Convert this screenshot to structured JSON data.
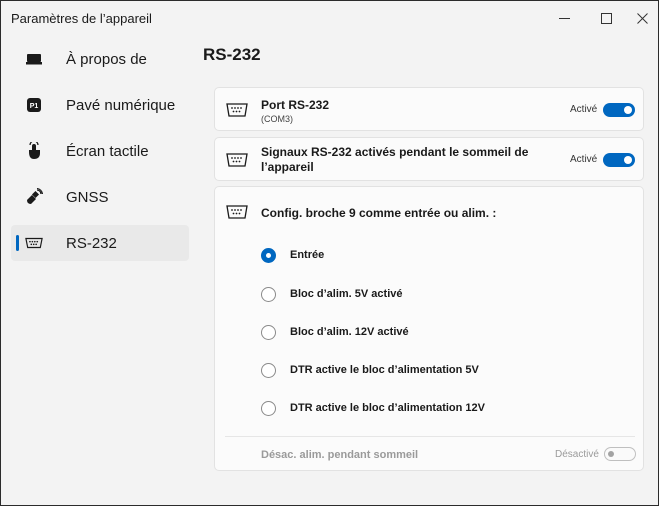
{
  "window": {
    "title": "Paramètres de l’appareil",
    "controls": {
      "minimize": "minimize-icon",
      "maximize": "maximize-icon",
      "close": "close-icon"
    }
  },
  "sidebar": {
    "items": [
      {
        "label": "À propos de",
        "icon": "keyboard-icon",
        "active": false
      },
      {
        "label": "Pavé numérique",
        "icon": "p1-key-icon",
        "active": false
      },
      {
        "label": "Écran tactile",
        "icon": "touch-hand-icon",
        "active": false
      },
      {
        "label": "GNSS",
        "icon": "satellite-icon",
        "active": false
      },
      {
        "label": "RS-232",
        "icon": "serial-port-icon",
        "active": true
      }
    ]
  },
  "page": {
    "title": "RS-232",
    "port": {
      "title": "Port RS-232",
      "subtitle": "(COM3)",
      "toggle_label": "Activé",
      "enabled": true
    },
    "sleep_signals": {
      "title_line1": "Signaux RS-232 activés pendant le sommeil de",
      "title_line2": "l’appareil",
      "toggle_label": "Activé",
      "enabled": true
    },
    "pin9": {
      "title": "Config. broche 9 comme entrée ou alim. :",
      "options": [
        {
          "label": "Entrée",
          "checked": true
        },
        {
          "label": "Bloc d’alim. 5V activé",
          "checked": false
        },
        {
          "label": "Bloc d’alim. 12V activé",
          "checked": false
        },
        {
          "label": "DTR active le bloc d’alimentation 5V",
          "checked": false
        },
        {
          "label": "DTR active le bloc d’alimentation 12V",
          "checked": false
        }
      ],
      "sleep_power": {
        "label": "Désac. alim. pendant sommeil",
        "toggle_label": "Désactivé",
        "enabled": false
      }
    }
  },
  "colors": {
    "accent": "#0067c0",
    "background": "#f3f3f3",
    "card": "#fbfbfb",
    "disabled_text": "#9a9a9a"
  }
}
